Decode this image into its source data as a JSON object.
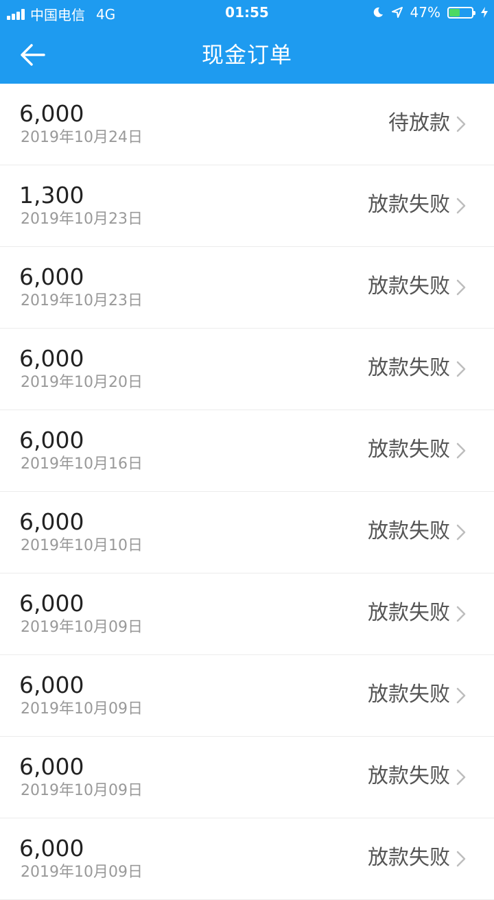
{
  "status_bar": {
    "carrier": "中国电信",
    "network": "4G",
    "time": "01:55",
    "battery_text": "47%",
    "battery_level": 0.47,
    "icons": [
      "signal-icon",
      "moon-icon",
      "location-arrow-icon",
      "battery-icon",
      "charging-icon"
    ]
  },
  "header": {
    "title": "现金订单",
    "back_icon": "back-arrow-icon"
  },
  "orders": [
    {
      "amount": "6,000",
      "date": "2019年10月24日",
      "status": "待放款"
    },
    {
      "amount": "1,300",
      "date": "2019年10月23日",
      "status": "放款失败"
    },
    {
      "amount": "6,000",
      "date": "2019年10月23日",
      "status": "放款失败"
    },
    {
      "amount": "6,000",
      "date": "2019年10月20日",
      "status": "放款失败"
    },
    {
      "amount": "6,000",
      "date": "2019年10月16日",
      "status": "放款失败"
    },
    {
      "amount": "6,000",
      "date": "2019年10月10日",
      "status": "放款失败"
    },
    {
      "amount": "6,000",
      "date": "2019年10月09日",
      "status": "放款失败"
    },
    {
      "amount": "6,000",
      "date": "2019年10月09日",
      "status": "放款失败"
    },
    {
      "amount": "6,000",
      "date": "2019年10月09日",
      "status": "放款失败"
    },
    {
      "amount": "6,000",
      "date": "2019年10月09日",
      "status": "放款失败"
    }
  ],
  "colors": {
    "header_bg": "#1e9bf0",
    "battery_fill": "#4cd964"
  }
}
